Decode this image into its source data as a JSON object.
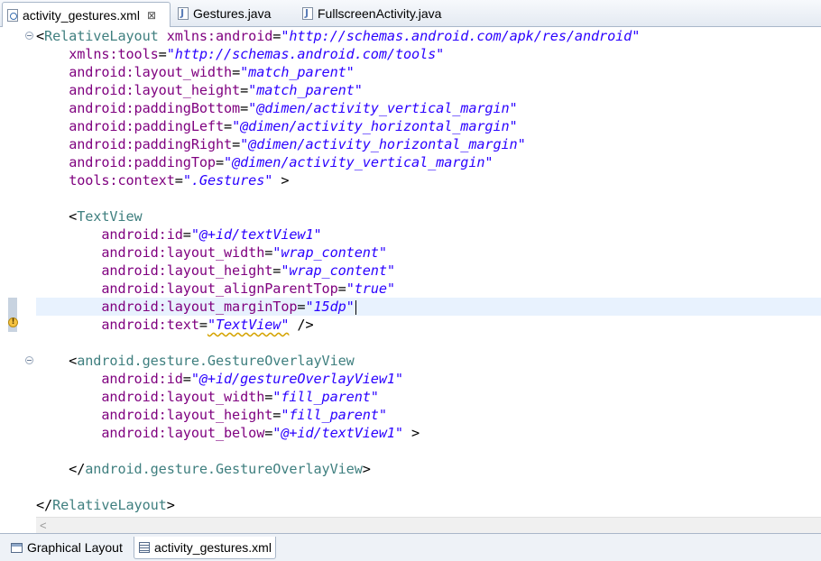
{
  "tabs": [
    {
      "label": "activity_gestures.xml",
      "icon": "xml-file-icon",
      "active": true,
      "close": "⊠"
    },
    {
      "label": "Gestures.java",
      "icon": "java-file-icon",
      "active": false
    },
    {
      "label": "FullscreenActivity.java",
      "icon": "java-file-icon",
      "active": false
    }
  ],
  "code_lines": [
    [
      [
        "pun",
        "<"
      ],
      [
        "tag",
        "RelativeLayout"
      ],
      [
        "pun",
        " "
      ],
      [
        "attr",
        "xmlns:android"
      ],
      [
        "pun",
        "="
      ],
      [
        "val",
        "\"http://schemas.android.com/apk/res/android\""
      ]
    ],
    [
      [
        "pun",
        "    "
      ],
      [
        "attr",
        "xmlns:tools"
      ],
      [
        "pun",
        "="
      ],
      [
        "val",
        "\"http://schemas.android.com/tools\""
      ]
    ],
    [
      [
        "pun",
        "    "
      ],
      [
        "attr",
        "android:layout_width"
      ],
      [
        "pun",
        "="
      ],
      [
        "val",
        "\"match_parent\""
      ]
    ],
    [
      [
        "pun",
        "    "
      ],
      [
        "attr",
        "android:layout_height"
      ],
      [
        "pun",
        "="
      ],
      [
        "val",
        "\"match_parent\""
      ]
    ],
    [
      [
        "pun",
        "    "
      ],
      [
        "attr",
        "android:paddingBottom"
      ],
      [
        "pun",
        "="
      ],
      [
        "val",
        "\"@dimen/activity_vertical_margin\""
      ]
    ],
    [
      [
        "pun",
        "    "
      ],
      [
        "attr",
        "android:paddingLeft"
      ],
      [
        "pun",
        "="
      ],
      [
        "val",
        "\"@dimen/activity_horizontal_margin\""
      ]
    ],
    [
      [
        "pun",
        "    "
      ],
      [
        "attr",
        "android:paddingRight"
      ],
      [
        "pun",
        "="
      ],
      [
        "val",
        "\"@dimen/activity_horizontal_margin\""
      ]
    ],
    [
      [
        "pun",
        "    "
      ],
      [
        "attr",
        "android:paddingTop"
      ],
      [
        "pun",
        "="
      ],
      [
        "val",
        "\"@dimen/activity_vertical_margin\""
      ]
    ],
    [
      [
        "pun",
        "    "
      ],
      [
        "attr",
        "tools:context"
      ],
      [
        "pun",
        "="
      ],
      [
        "val",
        "\".Gestures\""
      ],
      [
        "pun",
        " >"
      ]
    ],
    [],
    [
      [
        "pun",
        "    <"
      ],
      [
        "tag",
        "TextView"
      ]
    ],
    [
      [
        "pun",
        "        "
      ],
      [
        "attr",
        "android:id"
      ],
      [
        "pun",
        "="
      ],
      [
        "val",
        "\"@+id/textView1\""
      ]
    ],
    [
      [
        "pun",
        "        "
      ],
      [
        "attr",
        "android:layout_width"
      ],
      [
        "pun",
        "="
      ],
      [
        "val",
        "\"wrap_content\""
      ]
    ],
    [
      [
        "pun",
        "        "
      ],
      [
        "attr",
        "android:layout_height"
      ],
      [
        "pun",
        "="
      ],
      [
        "val",
        "\"wrap_content\""
      ]
    ],
    [
      [
        "pun",
        "        "
      ],
      [
        "attr",
        "android:layout_alignParentTop"
      ],
      [
        "pun",
        "="
      ],
      [
        "val",
        "\"true\""
      ]
    ],
    [
      [
        "pun",
        "        "
      ],
      [
        "attr",
        "android:layout_marginTop"
      ],
      [
        "pun",
        "="
      ],
      [
        "val",
        "\"15dp\""
      ],
      [
        "caret",
        ""
      ]
    ],
    [
      [
        "pun",
        "        "
      ],
      [
        "attr",
        "android:text"
      ],
      [
        "pun",
        "="
      ],
      [
        "valsq",
        "\"TextView\""
      ],
      [
        "pun",
        " />"
      ]
    ],
    [],
    [
      [
        "pun",
        "    <"
      ],
      [
        "tag",
        "android.gesture.GestureOverlayView"
      ]
    ],
    [
      [
        "pun",
        "        "
      ],
      [
        "attr",
        "android:id"
      ],
      [
        "pun",
        "="
      ],
      [
        "val",
        "\"@+id/gestureOverlayView1\""
      ]
    ],
    [
      [
        "pun",
        "        "
      ],
      [
        "attr",
        "android:layout_width"
      ],
      [
        "pun",
        "="
      ],
      [
        "val",
        "\"fill_parent\""
      ]
    ],
    [
      [
        "pun",
        "        "
      ],
      [
        "attr",
        "android:layout_height"
      ],
      [
        "pun",
        "="
      ],
      [
        "val",
        "\"fill_parent\""
      ]
    ],
    [
      [
        "pun",
        "        "
      ],
      [
        "attr",
        "android:layout_below"
      ],
      [
        "pun",
        "="
      ],
      [
        "val",
        "\"@+id/textView1\""
      ],
      [
        "pun",
        " >"
      ]
    ],
    [],
    [
      [
        "pun",
        "    </"
      ],
      [
        "tag",
        "android.gesture.GestureOverlayView"
      ],
      [
        "pun",
        ">"
      ]
    ],
    [],
    [
      [
        "pun",
        "</"
      ],
      [
        "tag",
        "RelativeLayout"
      ],
      [
        "pun",
        ">"
      ]
    ]
  ],
  "bottom_tabs": [
    {
      "label": "Graphical Layout",
      "icon": "graphical-layout-icon",
      "active": false
    },
    {
      "label": "activity_gestures.xml",
      "icon": "xml-source-icon",
      "active": true
    }
  ],
  "scroll_left_glyph": "<",
  "warning_glyph": "!",
  "colors": {
    "tag": "#3f7f7f",
    "attribute": "#7f007f",
    "value": "#2a00ff",
    "current_line": "#e8f2fe"
  }
}
